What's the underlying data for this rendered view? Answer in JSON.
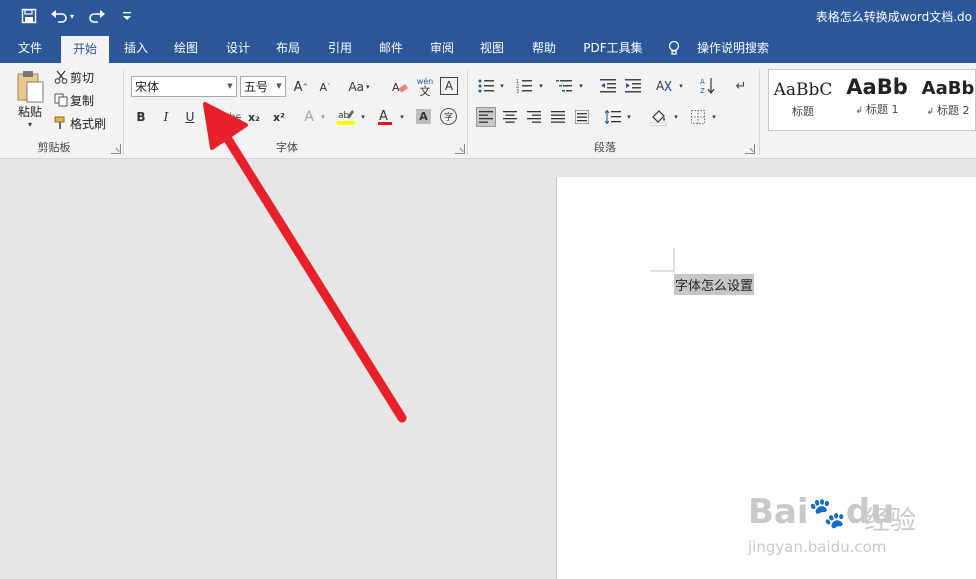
{
  "title_bar": {
    "document_title": "表格怎么转换成word文档.do",
    "save_icon": "save-icon",
    "undo_icon": "undo-icon",
    "redo_icon": "redo-icon",
    "customize_icon": "customize-quick-access-icon"
  },
  "tabs": [
    {
      "label": "文件"
    },
    {
      "label": "开始"
    },
    {
      "label": "插入"
    },
    {
      "label": "绘图"
    },
    {
      "label": "设计"
    },
    {
      "label": "布局"
    },
    {
      "label": "引用"
    },
    {
      "label": "邮件"
    },
    {
      "label": "审阅"
    },
    {
      "label": "视图"
    },
    {
      "label": "帮助"
    },
    {
      "label": "PDF工具集"
    }
  ],
  "tell_me": {
    "label": "操作说明搜索",
    "icon": "lightbulb-icon"
  },
  "clipboard": {
    "paste_label": "粘贴",
    "cut_label": "剪切",
    "copy_label": "复制",
    "format_painter_label": "格式刷",
    "group_label": "剪贴板"
  },
  "font": {
    "font_name": "宋体",
    "font_size": "五号",
    "bold": "B",
    "italic": "I",
    "underline": "U",
    "subscript": "x₂",
    "superscript": "x²",
    "change_case": "Aa",
    "pinyin_top": "wén",
    "pinyin_bottom": "文",
    "enclose": "字",
    "group_label": "字体"
  },
  "paragraph": {
    "group_label": "段落"
  },
  "styles": {
    "items": [
      {
        "sample": "AaBbC",
        "name": "标题"
      },
      {
        "sample": "AaBb",
        "name": "标题 1"
      },
      {
        "sample": "AaBb",
        "name": "标题 2"
      }
    ]
  },
  "document": {
    "selected_text": "字体怎么设置"
  },
  "watermark": {
    "brand": "Bai",
    "brand2": "du",
    "cn": "经验",
    "url": "jingyan.baidu.com"
  },
  "colors": {
    "title_bar": "#2b579a",
    "ribbon": "#f3f3f3",
    "canvas": "#e6e6e6",
    "arrow": "#e8202a",
    "highlight": "#ffff00",
    "font_color": "#e81123"
  }
}
